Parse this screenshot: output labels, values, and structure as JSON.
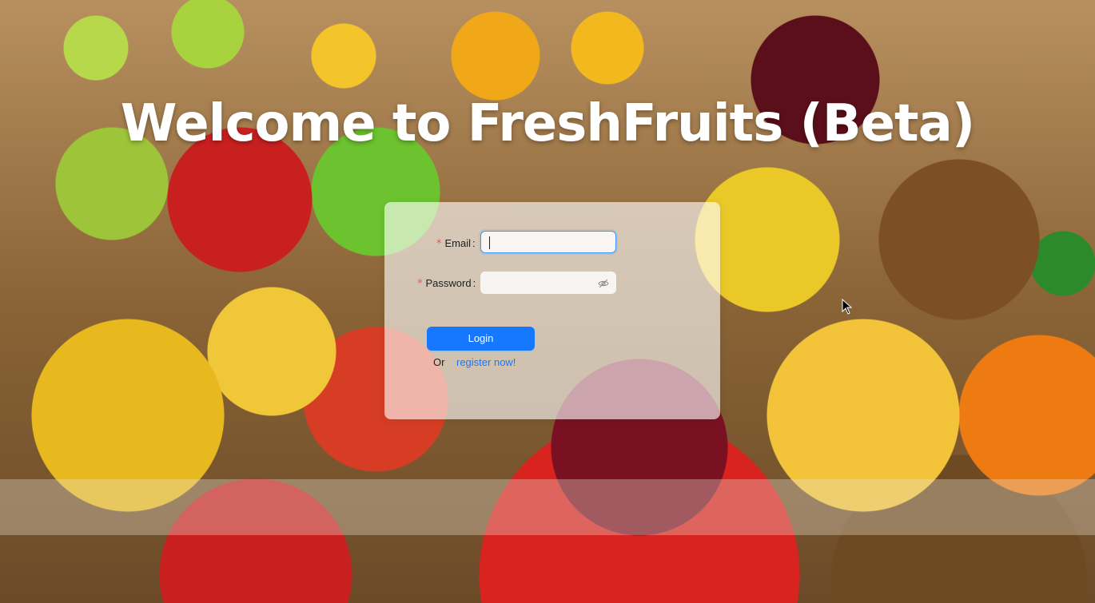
{
  "page": {
    "title": "Welcome to FreshFruits (Beta)"
  },
  "login_form": {
    "email": {
      "required_mark": "*",
      "label": "Email",
      "value": ""
    },
    "password": {
      "required_mark": "*",
      "label": "Password",
      "value": "",
      "visibility_icon": "eye-invisible-icon"
    },
    "submit_label": "Login",
    "or_text": "Or",
    "register_link": "register now!"
  },
  "colors": {
    "primary": "#1677ff",
    "required": "#ff4d4f",
    "title": "#ffffff"
  },
  "background": {
    "description_icon": "fruit-market-background"
  }
}
